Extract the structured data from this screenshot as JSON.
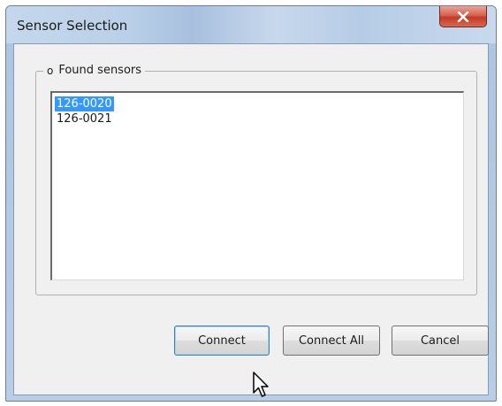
{
  "window": {
    "title": "Sensor Selection",
    "close_icon": "close-icon"
  },
  "group": {
    "legend_bullet": "o",
    "legend_label": "Found sensors"
  },
  "sensors": [
    {
      "label": "126-0020",
      "selected": true
    },
    {
      "label": "126-0021",
      "selected": false
    }
  ],
  "buttons": {
    "connect": "Connect",
    "connect_all": "Connect All",
    "cancel": "Cancel"
  },
  "colors": {
    "selection": "#3399ff",
    "close_button": "#c33a25",
    "dialog_background": "#f0f0f0"
  },
  "pointer": {
    "icon": "mouse-pointer-icon"
  }
}
